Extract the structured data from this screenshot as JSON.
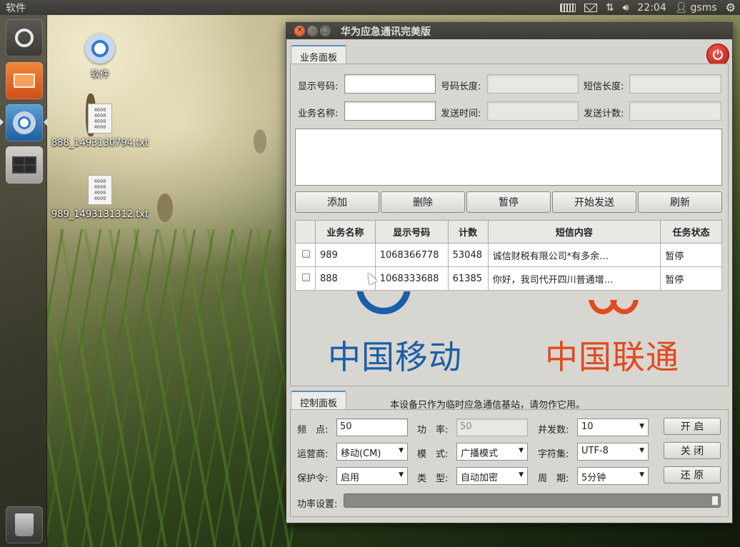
{
  "top_panel": {
    "app_name": "软件",
    "time": "22:04",
    "user": "gsms"
  },
  "desktop": {
    "icons": [
      {
        "label": "软件"
      },
      {
        "label": "888_1493130794.txt",
        "file_preview": "4600\n4600\n4600\n4600"
      },
      {
        "label": "989_1493131312.txt",
        "file_preview": "4600\n4600\n4600\n4600"
      }
    ]
  },
  "window": {
    "title": "华为应急通讯完美版"
  },
  "business_panel": {
    "tab_label": "业务面板",
    "labels": {
      "display_number": "显示号码:",
      "number_length": "号码长度:",
      "sms_length": "短信长度:",
      "business_name": "业务名称:",
      "send_time": "发送时间:",
      "send_count": "发送计数:"
    },
    "values": {
      "display_number": "",
      "number_length": "",
      "sms_length": "",
      "business_name": "",
      "send_time": "",
      "send_count": ""
    },
    "buttons": {
      "add": "添加",
      "delete": "删除",
      "pause": "暂停",
      "start_send": "开始发送",
      "refresh": "刷新"
    },
    "table": {
      "headers": [
        "",
        "业务名称",
        "显示号码",
        "计数",
        "短信内容",
        "任务状态"
      ],
      "rows": [
        {
          "name": "989",
          "number": "1068366778",
          "count": "53048",
          "content": "诚信财税有限公司*有多余…",
          "status": "暂停"
        },
        {
          "name": "888",
          "number": "1068333688",
          "count": "61385",
          "content": "你好，我司代开四川普通增…",
          "status": "暂停"
        }
      ]
    },
    "logos": {
      "china_mobile": "中国移动",
      "china_unicom": "中国联通"
    }
  },
  "control_panel": {
    "tab_label": "控制面板",
    "notice": "本设备只作为临时应急通信基站，请勿作它用。",
    "labels": {
      "frequency": "频　点:",
      "power": "功　率:",
      "concurrency": "并发数:",
      "operator": "运营商:",
      "mode": "模　式:",
      "charset": "字符集:",
      "protection": "保护令:",
      "type": "类　型:",
      "period": "周　期:",
      "power_setting": "功率设置:"
    },
    "values": {
      "frequency": "50",
      "power": "50",
      "concurrency": "10",
      "operator": "移动(CM)",
      "mode": "广播模式",
      "charset": "UTF-8",
      "protection": "启用",
      "type": "自动加密",
      "period": "5分钟",
      "power_slider_level": 1.0
    },
    "buttons": {
      "open": "开 启",
      "close": "关 闭",
      "restore": "还 原"
    }
  },
  "colors": {
    "china_mobile": "#1a5fa8",
    "china_unicom": "#e04a1e",
    "power_button": "#d0201a",
    "tab_accent": "#5c8ec8"
  }
}
